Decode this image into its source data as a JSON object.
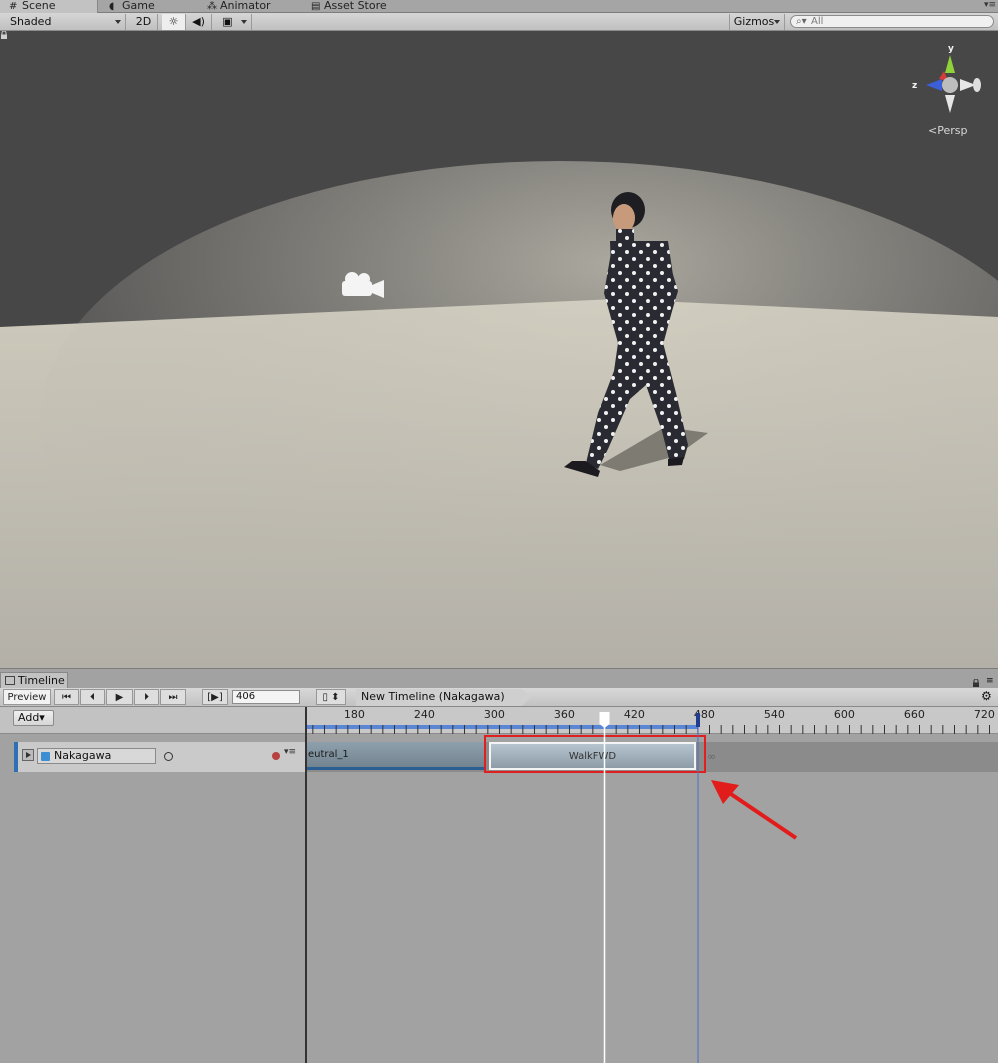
{
  "tabs": [
    {
      "label": "Scene",
      "icon": "grid-icon"
    },
    {
      "label": "Game",
      "icon": "pacman-icon"
    },
    {
      "label": "Animator",
      "icon": "animator-icon"
    },
    {
      "label": "Asset Store",
      "icon": "store-icon"
    }
  ],
  "scene_toolbar": {
    "shading_mode": "Shaded",
    "toggle_2d": "2D",
    "lighting_icon": "sun-icon",
    "audio_icon": "speaker-icon",
    "effects_icon": "image-icon",
    "gizmos_label": "Gizmos",
    "search_placeholder": "All"
  },
  "scene_view": {
    "gizmo_axes": {
      "y": "y",
      "z": "z"
    },
    "projection_label": "Persp",
    "colors": {
      "sky": "#474747",
      "ground": "#c7c2b4"
    }
  },
  "timeline": {
    "tab_label": "Timeline",
    "preview_label": "Preview",
    "frame_value": "406",
    "asset_name": "New Timeline (Nakagawa)",
    "add_label": "Add",
    "ruler_ticks": [
      "180",
      "240",
      "300",
      "360",
      "420",
      "480",
      "540",
      "600",
      "660",
      "720"
    ],
    "playhead_frame": 406,
    "track": {
      "name": "Nakagawa"
    },
    "clips": [
      {
        "label": "eutral_1"
      },
      {
        "label": "WalkFWD"
      }
    ]
  }
}
